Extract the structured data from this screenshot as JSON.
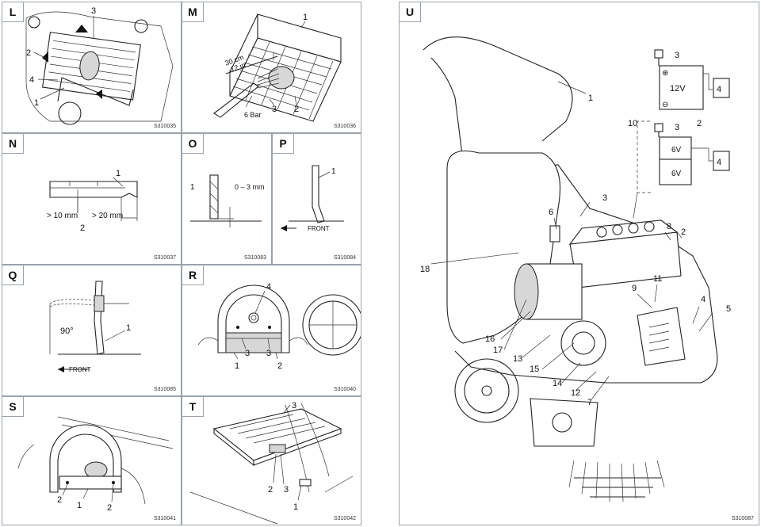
{
  "panels": {
    "L": {
      "label": "L",
      "code": "S310035",
      "callouts": [
        "3",
        "2",
        "4",
        "1"
      ]
    },
    "M": {
      "label": "M",
      "code": "S310036",
      "callouts": [
        "1",
        "3",
        "2"
      ],
      "dim_cm": "30 cm",
      "dim_in": "12 in",
      "pressure": "6 Bar"
    },
    "N": {
      "label": "N",
      "code": "S310037",
      "callouts": [
        "1",
        "2"
      ],
      "dim_a": "> 10 mm",
      "dim_b": "> 20 mm"
    },
    "O": {
      "label": "O",
      "code": "S310083",
      "callouts": [
        "1"
      ],
      "gap": "0 – 3 mm"
    },
    "P": {
      "label": "P",
      "code": "S310084",
      "callouts": [
        "1"
      ],
      "direction": "FRONT"
    },
    "Q": {
      "label": "Q",
      "code": "S310085",
      "callouts": [
        "1"
      ],
      "angle": "90°",
      "direction": "FRONT"
    },
    "R": {
      "label": "R",
      "code": "S310040",
      "callouts": [
        "4",
        "3",
        "3",
        "1",
        "2"
      ]
    },
    "S": {
      "label": "S",
      "code": "S310041",
      "callouts": [
        "2",
        "1",
        "2"
      ]
    },
    "T": {
      "label": "T",
      "code": "S310042",
      "callouts": [
        "3",
        "2",
        "3",
        "1"
      ]
    },
    "U": {
      "label": "U",
      "code": "S310087",
      "battery_12v": "12V",
      "battery_6v": "6V",
      "callouts": {
        "c1": "1",
        "c2": "2",
        "c3": "3",
        "c3b": "3",
        "c3c": "3",
        "c4": "4",
        "c4b": "4",
        "c5": "5",
        "c6": "6",
        "c7": "7",
        "c8": "8",
        "c2b": "2",
        "c9": "9",
        "c10": "10",
        "c11": "11",
        "c12": "12",
        "c13": "13",
        "c14": "14",
        "c15": "15",
        "c16": "16",
        "c17": "17",
        "c18": "18"
      }
    }
  }
}
